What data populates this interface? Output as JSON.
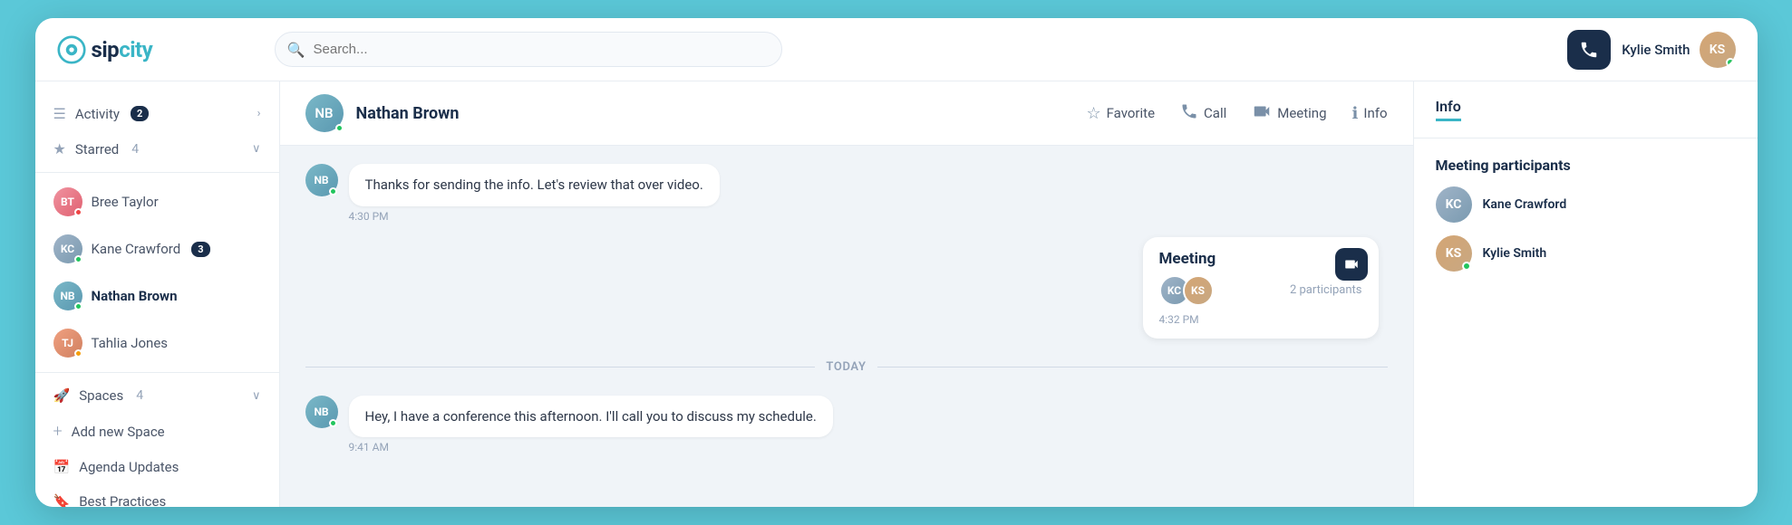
{
  "app": {
    "name": "sipcity",
    "logo_sip": "sip",
    "logo_city": "city"
  },
  "topbar": {
    "search_placeholder": "Search...",
    "phone_icon": "📞",
    "user_name": "Kylie Smith",
    "user_initials": "KS"
  },
  "sidebar": {
    "activity_label": "Activity",
    "activity_badge": "2",
    "starred_label": "Starred",
    "starred_count": "4",
    "contacts": [
      {
        "name": "Bree Taylor",
        "initials": "BT",
        "status": "busy",
        "color": "#e06070",
        "bg2": "#f093a0"
      },
      {
        "name": "Kane Crawford",
        "initials": "KC",
        "status": "online",
        "color": "#7a9ab0",
        "bg2": "#a0b4c8",
        "badge": "3"
      },
      {
        "name": "Nathan Brown",
        "initials": "NB",
        "status": "online",
        "color": "#5a98b0",
        "bg2": "#7ab8c8",
        "active": true
      },
      {
        "name": "Tahlia Jones",
        "initials": "TJ",
        "status": "away",
        "color": "#d08060",
        "bg2": "#f0a080"
      }
    ],
    "spaces_label": "Spaces",
    "spaces_count": "4",
    "add_space_label": "Add new Space",
    "space_items": [
      {
        "name": "Agenda Updates",
        "icon": "📅"
      },
      {
        "name": "Best Practices",
        "icon": "🔖"
      }
    ]
  },
  "chat": {
    "contact_name": "Nathan Brown",
    "contact_initials": "NB",
    "actions": [
      {
        "label": "Favorite",
        "icon": "☆",
        "name": "favorite"
      },
      {
        "label": "Call",
        "icon": "📞",
        "name": "call"
      },
      {
        "label": "Meeting",
        "icon": "📹",
        "name": "meeting"
      },
      {
        "label": "Info",
        "icon": "ℹ️",
        "name": "info"
      }
    ],
    "messages": [
      {
        "sender": "Nathan Brown",
        "initials": "NB",
        "text": "Thanks for sending the info. Let's review that over video.",
        "time": "4:30 PM",
        "status": "online"
      }
    ],
    "meeting_card": {
      "title": "Meeting",
      "participants_count": "2 participants",
      "time": "4:32 PM"
    },
    "today_label": "TODAY",
    "today_message": {
      "sender": "Nathan Brown",
      "initials": "NB",
      "text": "Hey, I have a conference this afternoon. I'll call you to discuss my schedule.",
      "time": "9:41 AM"
    }
  },
  "info_panel": {
    "tab_label": "Info",
    "meeting_participants_title": "Meeting participants"
  }
}
